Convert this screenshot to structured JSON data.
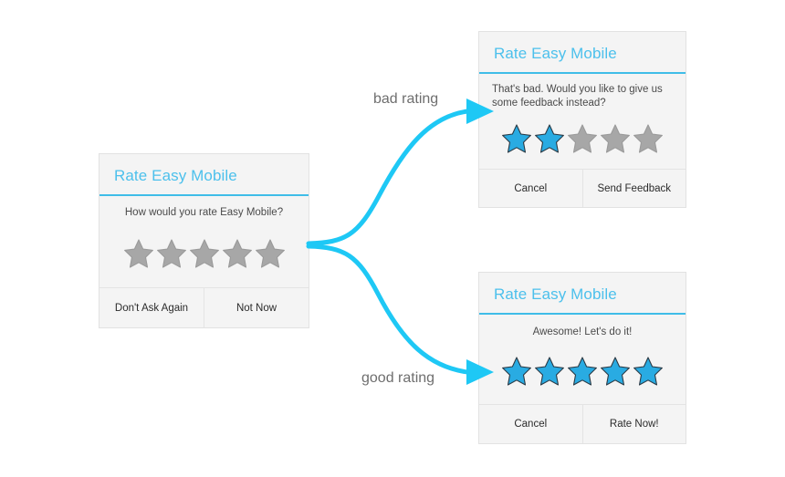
{
  "diagram": {
    "accent_color": "#3fbde8",
    "arrow_color": "#1ec8f5",
    "star_active_color": "#29abe2",
    "star_inactive_color": "#a7a7a7",
    "labels": {
      "bad": "bad rating",
      "good": "good rating"
    }
  },
  "dialogs": {
    "initial": {
      "title": "Rate Easy Mobile",
      "message": "How would you rate Easy Mobile?",
      "message_align": "center",
      "rating": 0,
      "star_count": 5,
      "buttons": [
        {
          "label": "Don't Ask Again",
          "name": "dont-ask-again-button"
        },
        {
          "label": "Not Now",
          "name": "not-now-button"
        }
      ]
    },
    "bad": {
      "title": "Rate Easy Mobile",
      "message": "That's bad. Would you like to give us some feedback instead?",
      "message_align": "left",
      "rating": 2,
      "star_count": 5,
      "buttons": [
        {
          "label": "Cancel",
          "name": "cancel-button"
        },
        {
          "label": "Send Feedback",
          "name": "send-feedback-button"
        }
      ]
    },
    "good": {
      "title": "Rate Easy Mobile",
      "message": "Awesome! Let's do it!",
      "message_align": "center",
      "rating": 5,
      "star_count": 5,
      "buttons": [
        {
          "label": "Cancel",
          "name": "cancel-button"
        },
        {
          "label": "Rate Now!",
          "name": "rate-now-button"
        }
      ]
    }
  }
}
